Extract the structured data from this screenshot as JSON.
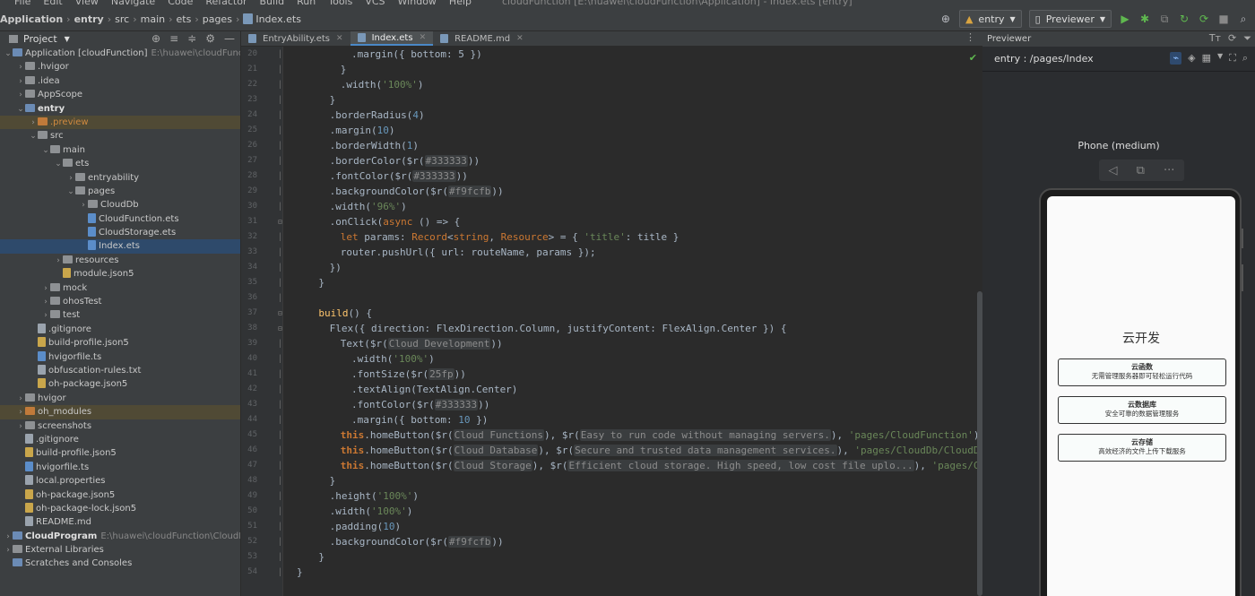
{
  "menubar": {
    "items": [
      "File",
      "Edit",
      "View",
      "Navigate",
      "Code",
      "Refactor",
      "Build",
      "Run",
      "Tools",
      "VCS",
      "Window",
      "Help"
    ],
    "window_title": "cloudFunction [E:\\huawei\\cloudFunction\\Application] - Index.ets [entry]"
  },
  "breadcrumb": {
    "items": [
      "Application",
      "entry",
      "src",
      "main",
      "ets",
      "pages"
    ],
    "file": "Index.ets"
  },
  "toolbar": {
    "module_combo": "entry",
    "device_combo": "Previewer"
  },
  "project_panel": {
    "title": "Project",
    "tree": [
      {
        "label": "Application [cloudFunction]",
        "path": "E:\\huawei\\cloudFunctio",
        "level": 0,
        "type": "module",
        "arrow": "down",
        "bold_part": true
      },
      {
        "label": ".hvigor",
        "level": 1,
        "type": "folder",
        "arrow": "right"
      },
      {
        "label": ".idea",
        "level": 1,
        "type": "folder",
        "arrow": "right"
      },
      {
        "label": "AppScope",
        "level": 1,
        "type": "folder",
        "arrow": "right"
      },
      {
        "label": "entry",
        "level": 1,
        "type": "folder-blue",
        "arrow": "down",
        "bold": true
      },
      {
        "label": ".preview",
        "level": 2,
        "type": "folder-orange",
        "arrow": "right",
        "highlight": true,
        "orange": true
      },
      {
        "label": "src",
        "level": 2,
        "type": "folder",
        "arrow": "down"
      },
      {
        "label": "main",
        "level": 3,
        "type": "folder",
        "arrow": "down"
      },
      {
        "label": "ets",
        "level": 4,
        "type": "folder",
        "arrow": "down"
      },
      {
        "label": "entryability",
        "level": 5,
        "type": "folder",
        "arrow": "right"
      },
      {
        "label": "pages",
        "level": 5,
        "type": "folder",
        "arrow": "down"
      },
      {
        "label": "CloudDb",
        "level": 6,
        "type": "folder",
        "arrow": "right"
      },
      {
        "label": "CloudFunction.ets",
        "level": 6,
        "type": "file-ts",
        "arrow": ""
      },
      {
        "label": "CloudStorage.ets",
        "level": 6,
        "type": "file-ts",
        "arrow": ""
      },
      {
        "label": "Index.ets",
        "level": 6,
        "type": "file-ts",
        "arrow": "",
        "selected": true
      },
      {
        "label": "resources",
        "level": 4,
        "type": "folder",
        "arrow": "right"
      },
      {
        "label": "module.json5",
        "level": 4,
        "type": "file-json",
        "arrow": ""
      },
      {
        "label": "mock",
        "level": 3,
        "type": "folder",
        "arrow": "right"
      },
      {
        "label": "ohosTest",
        "level": 3,
        "type": "folder",
        "arrow": "right"
      },
      {
        "label": "test",
        "level": 3,
        "type": "folder",
        "arrow": "right"
      },
      {
        "label": ".gitignore",
        "level": 2,
        "type": "file",
        "arrow": ""
      },
      {
        "label": "build-profile.json5",
        "level": 2,
        "type": "file-json",
        "arrow": ""
      },
      {
        "label": "hvigorfile.ts",
        "level": 2,
        "type": "file-ts",
        "arrow": ""
      },
      {
        "label": "obfuscation-rules.txt",
        "level": 2,
        "type": "file",
        "arrow": ""
      },
      {
        "label": "oh-package.json5",
        "level": 2,
        "type": "file-json",
        "arrow": ""
      },
      {
        "label": "hvigor",
        "level": 1,
        "type": "folder",
        "arrow": "right"
      },
      {
        "label": "oh_modules",
        "level": 1,
        "type": "folder-orange",
        "arrow": "right",
        "highlight": true
      },
      {
        "label": "screenshots",
        "level": 1,
        "type": "folder",
        "arrow": "right"
      },
      {
        "label": ".gitignore",
        "level": 1,
        "type": "file",
        "arrow": ""
      },
      {
        "label": "build-profile.json5",
        "level": 1,
        "type": "file-json",
        "arrow": ""
      },
      {
        "label": "hvigorfile.ts",
        "level": 1,
        "type": "file-ts",
        "arrow": ""
      },
      {
        "label": "local.properties",
        "level": 1,
        "type": "file",
        "arrow": ""
      },
      {
        "label": "oh-package.json5",
        "level": 1,
        "type": "file-json",
        "arrow": ""
      },
      {
        "label": "oh-package-lock.json5",
        "level": 1,
        "type": "file-json",
        "arrow": ""
      },
      {
        "label": "README.md",
        "level": 1,
        "type": "file",
        "arrow": ""
      },
      {
        "label": "CloudProgram",
        "path": "E:\\huawei\\cloudFunction\\CloudProg",
        "level": 0,
        "type": "module",
        "arrow": "right",
        "bold": true
      },
      {
        "label": "External Libraries",
        "level": 0,
        "type": "folder",
        "arrow": "right"
      },
      {
        "label": "Scratches and Consoles",
        "level": 0,
        "type": "folder-blue",
        "arrow": ""
      }
    ]
  },
  "editor": {
    "tabs": [
      {
        "label": "EntryAbility.ets",
        "active": false
      },
      {
        "label": "Index.ets",
        "active": true
      },
      {
        "label": "README.md",
        "active": false
      }
    ],
    "lines": [
      {
        "n": "20",
        "indent": 5,
        "tokens": [
          [
            "t",
            ".margin({ bottom: 5 })"
          ]
        ]
      },
      {
        "n": "21",
        "indent": 4,
        "tokens": [
          [
            "t",
            "}"
          ]
        ]
      },
      {
        "n": "22",
        "indent": 4,
        "tokens": [
          [
            "t",
            ".width("
          ],
          [
            "str",
            "'100%'"
          ],
          [
            "t",
            ")"
          ]
        ]
      },
      {
        "n": "23",
        "indent": 3,
        "tokens": [
          [
            "t",
            "}"
          ]
        ]
      },
      {
        "n": "24",
        "indent": 3,
        "tokens": [
          [
            "t",
            ".borderRadius("
          ],
          [
            "num",
            "4"
          ],
          [
            "t",
            ")"
          ]
        ]
      },
      {
        "n": "25",
        "indent": 3,
        "tokens": [
          [
            "t",
            ".margin("
          ],
          [
            "num",
            "10"
          ],
          [
            "t",
            ")"
          ]
        ]
      },
      {
        "n": "26",
        "indent": 3,
        "tokens": [
          [
            "t",
            ".borderWidth("
          ],
          [
            "num",
            "1"
          ],
          [
            "t",
            ")"
          ]
        ]
      },
      {
        "n": "27",
        "indent": 3,
        "tokens": [
          [
            "t",
            ".borderColor($r("
          ],
          [
            "hint",
            "#333333"
          ],
          [
            "t",
            "))"
          ]
        ]
      },
      {
        "n": "28",
        "indent": 3,
        "tokens": [
          [
            "t",
            ".fontColor($r("
          ],
          [
            "hint",
            "#333333"
          ],
          [
            "t",
            "))"
          ]
        ]
      },
      {
        "n": "29",
        "indent": 3,
        "tokens": [
          [
            "t",
            ".backgroundColor($r("
          ],
          [
            "hint",
            "#f9fcfb"
          ],
          [
            "t",
            "))"
          ]
        ]
      },
      {
        "n": "30",
        "indent": 3,
        "tokens": [
          [
            "t",
            ".width("
          ],
          [
            "str",
            "'96%'"
          ],
          [
            "t",
            ")"
          ]
        ]
      },
      {
        "n": "31",
        "indent": 3,
        "tokens": [
          [
            "t",
            ".onClick("
          ],
          [
            "kw",
            "async"
          ],
          [
            "t",
            " () => {"
          ]
        ]
      },
      {
        "n": "32",
        "indent": 4,
        "tokens": [
          [
            "kw",
            "let"
          ],
          [
            "t",
            " params: "
          ],
          [
            "type",
            "Record"
          ],
          [
            "t",
            "<"
          ],
          [
            "type",
            "string"
          ],
          [
            "t",
            ", "
          ],
          [
            "type",
            "Resource"
          ],
          [
            "t",
            "> = { "
          ],
          [
            "str",
            "'title'"
          ],
          [
            "t",
            ": title }"
          ]
        ]
      },
      {
        "n": "33",
        "indent": 4,
        "tokens": [
          [
            "t",
            "router.pushUrl({ url: routeName, params });"
          ]
        ]
      },
      {
        "n": "34",
        "indent": 3,
        "tokens": [
          [
            "t",
            "})"
          ]
        ]
      },
      {
        "n": "35",
        "indent": 2,
        "tokens": [
          [
            "t",
            "}"
          ]
        ]
      },
      {
        "n": "36",
        "indent": 0,
        "tokens": [
          [
            "t",
            ""
          ]
        ]
      },
      {
        "n": "37",
        "indent": 2,
        "tokens": [
          [
            "fn",
            "build"
          ],
          [
            "t",
            "() {"
          ]
        ]
      },
      {
        "n": "38",
        "indent": 3,
        "tokens": [
          [
            "t",
            "Flex({ direction: FlexDirection.Column, justifyContent: FlexAlign.Center }) {"
          ]
        ]
      },
      {
        "n": "39",
        "indent": 4,
        "tokens": [
          [
            "t",
            "Text($r("
          ],
          [
            "hint",
            "Cloud Development"
          ],
          [
            "t",
            "))"
          ]
        ]
      },
      {
        "n": "40",
        "indent": 5,
        "tokens": [
          [
            "t",
            ".width("
          ],
          [
            "str",
            "'100%'"
          ],
          [
            "t",
            ")"
          ]
        ]
      },
      {
        "n": "41",
        "indent": 5,
        "tokens": [
          [
            "t",
            ".fontSize($r("
          ],
          [
            "hint",
            "25fp"
          ],
          [
            "t",
            "))"
          ]
        ]
      },
      {
        "n": "42",
        "indent": 5,
        "tokens": [
          [
            "t",
            ".textAlign(TextAlign.Center)"
          ]
        ]
      },
      {
        "n": "43",
        "indent": 5,
        "tokens": [
          [
            "t",
            ".fontColor($r("
          ],
          [
            "hint",
            "#333333"
          ],
          [
            "t",
            "))"
          ]
        ]
      },
      {
        "n": "44",
        "indent": 5,
        "tokens": [
          [
            "t",
            ".margin({ bottom: "
          ],
          [
            "num",
            "10"
          ],
          [
            "t",
            " })"
          ]
        ]
      },
      {
        "n": "45",
        "indent": 4,
        "tokens": [
          [
            "this",
            "this"
          ],
          [
            "t",
            ".homeButton($r("
          ],
          [
            "hint",
            "Cloud Functions"
          ],
          [
            "t",
            "), $r("
          ],
          [
            "hint",
            "Easy to run code without managing servers."
          ],
          [
            "t",
            "), "
          ],
          [
            "str",
            "'pages/CloudFunction'"
          ],
          [
            "t",
            ")"
          ]
        ]
      },
      {
        "n": "46",
        "indent": 4,
        "tokens": [
          [
            "this",
            "this"
          ],
          [
            "t",
            ".homeButton($r("
          ],
          [
            "hint",
            "Cloud Database"
          ],
          [
            "t",
            "), $r("
          ],
          [
            "hint",
            "Secure and trusted data management services."
          ],
          [
            "t",
            "), "
          ],
          [
            "str",
            "'pages/CloudDb/CloudDb'"
          ],
          [
            "t",
            ",)"
          ]
        ]
      },
      {
        "n": "47",
        "indent": 4,
        "tokens": [
          [
            "this",
            "this"
          ],
          [
            "t",
            ".homeButton($r("
          ],
          [
            "hint",
            "Cloud Storage"
          ],
          [
            "t",
            "), $r("
          ],
          [
            "hint",
            "Efficient cloud storage. High speed, low cost file uplo..."
          ],
          [
            "t",
            "), "
          ],
          [
            "str",
            "'pages/CloudStorage'"
          ],
          [
            "t",
            ")"
          ]
        ]
      },
      {
        "n": "48",
        "indent": 3,
        "tokens": [
          [
            "t",
            "}"
          ]
        ]
      },
      {
        "n": "49",
        "indent": 3,
        "tokens": [
          [
            "t",
            ".height("
          ],
          [
            "str",
            "'100%'"
          ],
          [
            "t",
            ")"
          ]
        ]
      },
      {
        "n": "50",
        "indent": 3,
        "tokens": [
          [
            "t",
            ".width("
          ],
          [
            "str",
            "'100%'"
          ],
          [
            "t",
            ")"
          ]
        ]
      },
      {
        "n": "51",
        "indent": 3,
        "tokens": [
          [
            "t",
            ".padding("
          ],
          [
            "num",
            "10"
          ],
          [
            "t",
            ")"
          ]
        ]
      },
      {
        "n": "52",
        "indent": 3,
        "tokens": [
          [
            "t",
            ".backgroundColor($r("
          ],
          [
            "hint",
            "#f9fcfb"
          ],
          [
            "t",
            "))"
          ]
        ]
      },
      {
        "n": "53",
        "indent": 2,
        "tokens": [
          [
            "t",
            "}"
          ]
        ]
      },
      {
        "n": "54",
        "indent": 0,
        "tokens": [
          [
            "t",
            "}"
          ]
        ]
      }
    ]
  },
  "previewer": {
    "title": "Previewer",
    "route": "entry : /pages/Index",
    "device": "Phone (medium)",
    "app": {
      "title": "云开发",
      "buttons": [
        {
          "title": "云函数",
          "subtitle": "无需管理服务器即可轻松运行代码"
        },
        {
          "title": "云数据库",
          "subtitle": "安全可靠的数据管理服务"
        },
        {
          "title": "云存储",
          "subtitle": "高效经济的文件上传下载服务"
        }
      ]
    }
  },
  "colors": {
    "accent": "#4a88c7",
    "selection": "#2e4a6b",
    "run_green": "#5fb84f"
  }
}
